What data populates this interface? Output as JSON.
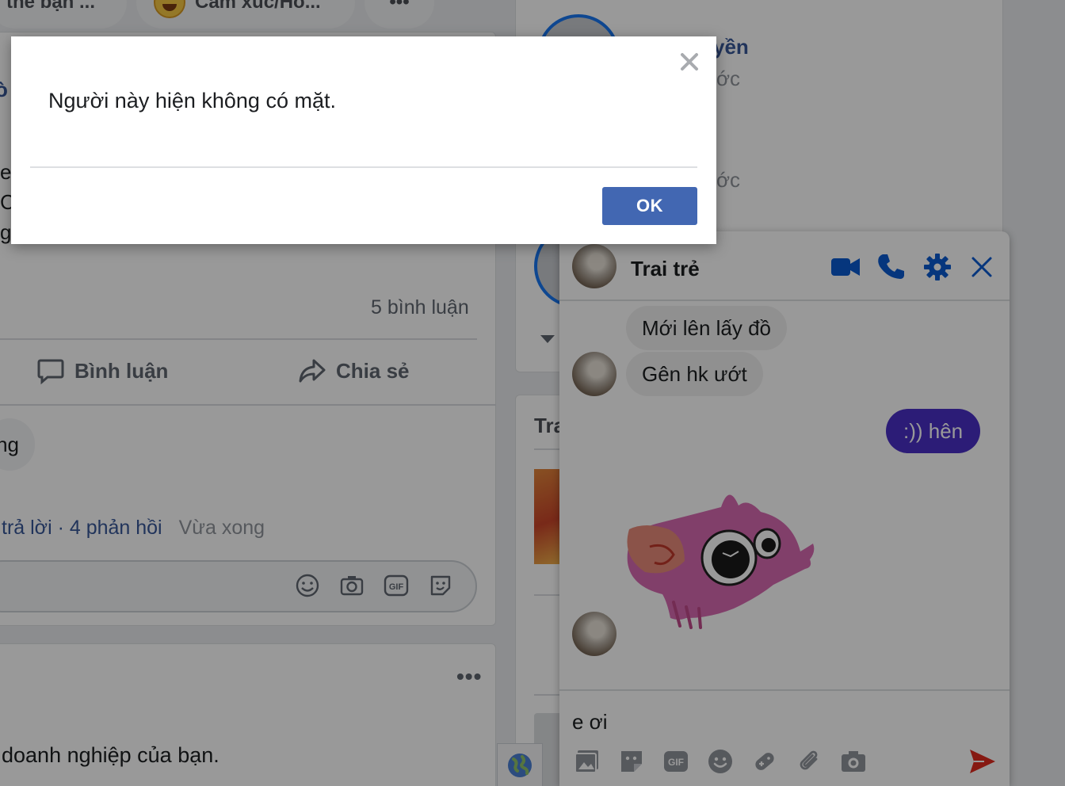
{
  "feed": {
    "chip_tag_label": "thẻ bạn ...",
    "chip_feeling_label": "Cảm xúc/Ho...",
    "chip_more_label": "•••",
    "comment_count": "5 bình luận",
    "comment_button_label": "Bình luận",
    "share_button_label": "Chia sẻ",
    "comment_fragment": "ng",
    "reply_link": "trả lời · 4 phản hồi",
    "reply_time": "Vừa xong",
    "post2_more": "•••",
    "post2_text": "doanh nghiệp của bạn.",
    "partial_texts": [
      "e",
      "C",
      "g"
    ]
  },
  "sidebar": {
    "contact_name_fragment": "yền",
    "contact_sub_1": "ớc",
    "contact_sub_2": "ớc",
    "trending_title_fragment": "Tra"
  },
  "chat": {
    "contact_name": "Trai trẻ",
    "messages": [
      {
        "direction": "in",
        "text": "Mới lên lấy đồ"
      },
      {
        "direction": "in",
        "text": "Gên hk ướt"
      },
      {
        "direction": "out",
        "text": ":)) hên"
      }
    ],
    "sticker": "pink-bird-sticker",
    "composer_text": "e ơi",
    "colors": {
      "accent": "#0a5bd1",
      "outgoing_bubble": "#4a2fc7",
      "send": "#e02a1e"
    }
  },
  "dialog": {
    "message": "Người này hiện không có mặt.",
    "ok_label": "OK",
    "close_icon": "close-icon"
  },
  "colors": {
    "primary_button": "#4267b2",
    "link": "#385898"
  }
}
